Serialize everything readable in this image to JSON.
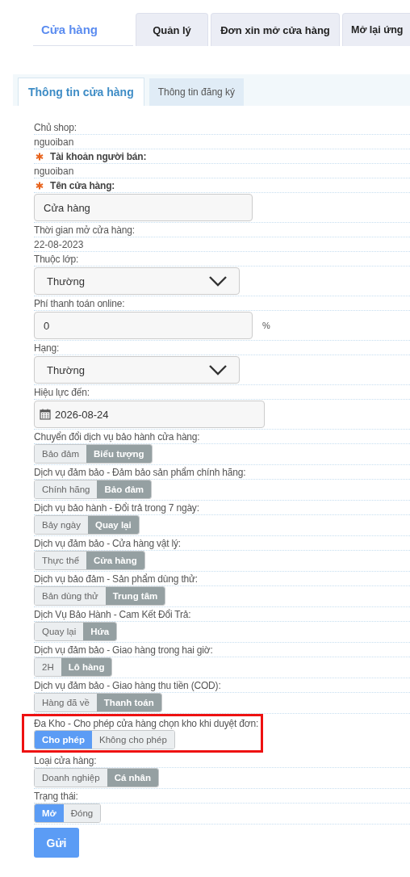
{
  "top_tabs": [
    {
      "label": "Cửa hàng",
      "selected": true
    },
    {
      "label": "Quản lý",
      "selected": false
    },
    {
      "label": "Đơn xin mở cửa hàng",
      "selected": false
    },
    {
      "label": "Mở lại ứng",
      "selected": false
    }
  ],
  "sub_tabs": [
    {
      "label": "Thông tin cửa hàng",
      "selected": true
    },
    {
      "label": "Thông tin đăng ký",
      "selected": false
    }
  ],
  "fields": [
    {
      "kind": "text",
      "label": "Chủ shop:",
      "value": "nguoiban",
      "required": false
    },
    {
      "kind": "text",
      "label": "Tài khoản người bán:",
      "value": "nguoiban",
      "required": true
    },
    {
      "kind": "input",
      "label": "Tên cửa hàng:",
      "value": "Cửa hàng",
      "required": true
    },
    {
      "kind": "text",
      "label": "Thời gian mở cửa hàng:",
      "value": "22-08-2023",
      "required": false
    },
    {
      "kind": "select",
      "label": "Thuộc lớp:",
      "value": "Thường",
      "required": false
    },
    {
      "kind": "input",
      "label": "Phí thanh toán online:",
      "value": "0",
      "unit": "%",
      "required": false
    },
    {
      "kind": "select",
      "label": "Hạng:",
      "value": "Thường",
      "required": false
    },
    {
      "kind": "date",
      "label": "Hiệu lực đến:",
      "value": "2026-08-24",
      "required": false
    },
    {
      "kind": "toggle",
      "label": "Chuyển đổi dịch vụ bảo hành cửa hàng:",
      "on_label": "Bảo đảm",
      "off_label": "Biểu tượng",
      "on": false,
      "highlighted": false
    },
    {
      "kind": "toggle",
      "label": "Dịch vụ đảm bảo - Đảm bảo sản phẩm chính hãng:",
      "on_label": "Chính hãng",
      "off_label": "Bảo đảm",
      "on": false,
      "highlighted": false
    },
    {
      "kind": "toggle",
      "label": "Dịch vụ bảo hành - Đổi trả trong 7 ngày:",
      "on_label": "Bảy ngày",
      "off_label": "Quay lại",
      "on": false,
      "highlighted": false
    },
    {
      "kind": "toggle",
      "label": "Dịch vụ đảm bảo - Cửa hàng vật lý:",
      "on_label": "Thực thể",
      "off_label": "Cửa hàng",
      "on": false,
      "highlighted": false
    },
    {
      "kind": "toggle",
      "label": "Dịch vụ bảo đảm - Sản phẩm dùng thử:",
      "on_label": "Bản dùng thử",
      "off_label": "Trung tâm",
      "on": false,
      "highlighted": false
    },
    {
      "kind": "toggle",
      "label": "Dịch Vụ Bảo Hành - Cam Kết Đổi Trả:",
      "on_label": "Quay lại",
      "off_label": "Hứa",
      "on": false,
      "highlighted": false
    },
    {
      "kind": "toggle",
      "label": "Dịch vụ đảm bảo - Giao hàng trong hai giờ:",
      "on_label": "2H",
      "off_label": "Lô hàng",
      "on": false,
      "highlighted": false
    },
    {
      "kind": "toggle",
      "label": "Dịch vụ đảm bảo - Giao hàng thu tiền (COD):",
      "on_label": "Hàng đã về",
      "off_label": "Thanh toán",
      "on": false,
      "highlighted": false
    },
    {
      "kind": "toggle",
      "label": "Đa Kho - Cho phép cửa hàng chọn kho khi duyệt đơn:",
      "on_label": "Cho phép",
      "off_label": "Không cho phép",
      "on": true,
      "highlighted": true
    },
    {
      "kind": "toggle",
      "label": "Loại cửa hàng:",
      "on_label": "Doanh nghiệp",
      "off_label": "Cá nhân",
      "on": false,
      "highlighted": false
    },
    {
      "kind": "toggle",
      "label": "Trạng thái:",
      "on_label": "Mở",
      "off_label": "Đóng",
      "on": true,
      "highlighted": false
    }
  ],
  "submit": "Gửi"
}
